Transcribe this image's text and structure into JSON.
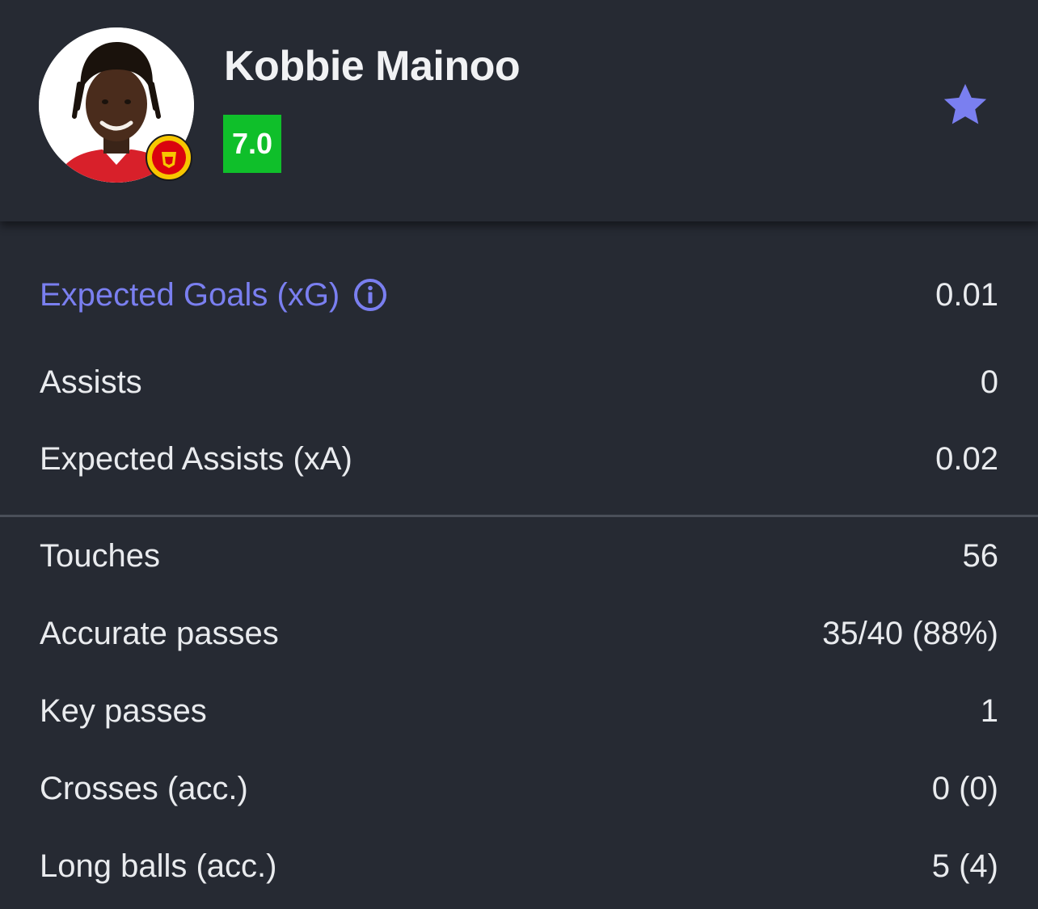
{
  "player": {
    "name": "Kobbie Mainoo",
    "rating": "7.0",
    "rating_color": "#0fbf2a",
    "club_badge_icon": "manchester-united-crest",
    "favorite_icon": "star-icon",
    "accent_color": "#7a7ff0"
  },
  "stats_primary": [
    {
      "label": "Expected Goals (xG)",
      "value": "0.01",
      "has_info": true
    },
    {
      "label": "Assists",
      "value": "0"
    },
    {
      "label": "Expected Assists (xA)",
      "value": "0.02"
    }
  ],
  "stats_secondary": [
    {
      "label": "Touches",
      "value": "56"
    },
    {
      "label": "Accurate passes",
      "value": "35/40 (88%)"
    },
    {
      "label": "Key passes",
      "value": "1"
    },
    {
      "label": "Crosses (acc.)",
      "value": "0 (0)"
    },
    {
      "label": "Long balls (acc.)",
      "value": "5 (4)"
    }
  ]
}
